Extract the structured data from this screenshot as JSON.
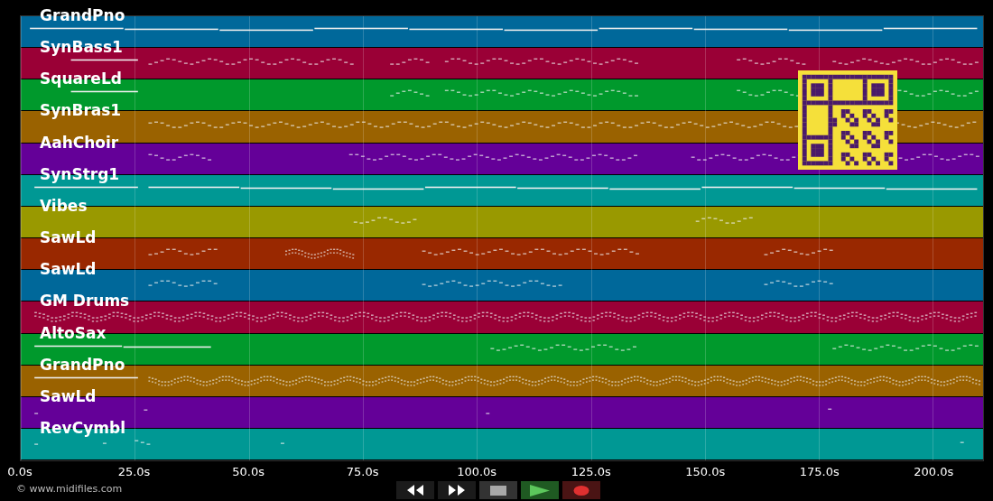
{
  "tracks": [
    {
      "name": "GrandPno",
      "color": "#00689a"
    },
    {
      "name": "SynBass1",
      "color": "#9a0036"
    },
    {
      "name": "SquareLd",
      "color": "#00992c"
    },
    {
      "name": "SynBras1",
      "color": "#9a6200"
    },
    {
      "name": "AahChoir",
      "color": "#640098"
    },
    {
      "name": "SynStrg1",
      "color": "#009894"
    },
    {
      "name": "Vibes",
      "color": "#999900"
    },
    {
      "name": "SawLd",
      "color": "#992800"
    },
    {
      "name": "SawLd",
      "color": "#00689a"
    },
    {
      "name": "GM Drums",
      "color": "#9a0036"
    },
    {
      "name": "AltoSax",
      "color": "#00992c"
    },
    {
      "name": "GrandPno",
      "color": "#9a6200"
    },
    {
      "name": "SawLd",
      "color": "#640098"
    },
    {
      "name": "RevCymbl",
      "color": "#009894"
    }
  ],
  "axis_ticks": [
    "0.0s",
    "25.0s",
    "50.0s",
    "75.0s",
    "100.0s",
    "125.0s",
    "150.0s",
    "175.0s",
    "200.0s"
  ],
  "credit": "© www.midifiles.com",
  "controls": [
    {
      "kind": "rewind"
    },
    {
      "kind": "forward"
    },
    {
      "kind": "stop"
    },
    {
      "kind": "play"
    },
    {
      "kind": "record"
    }
  ]
}
